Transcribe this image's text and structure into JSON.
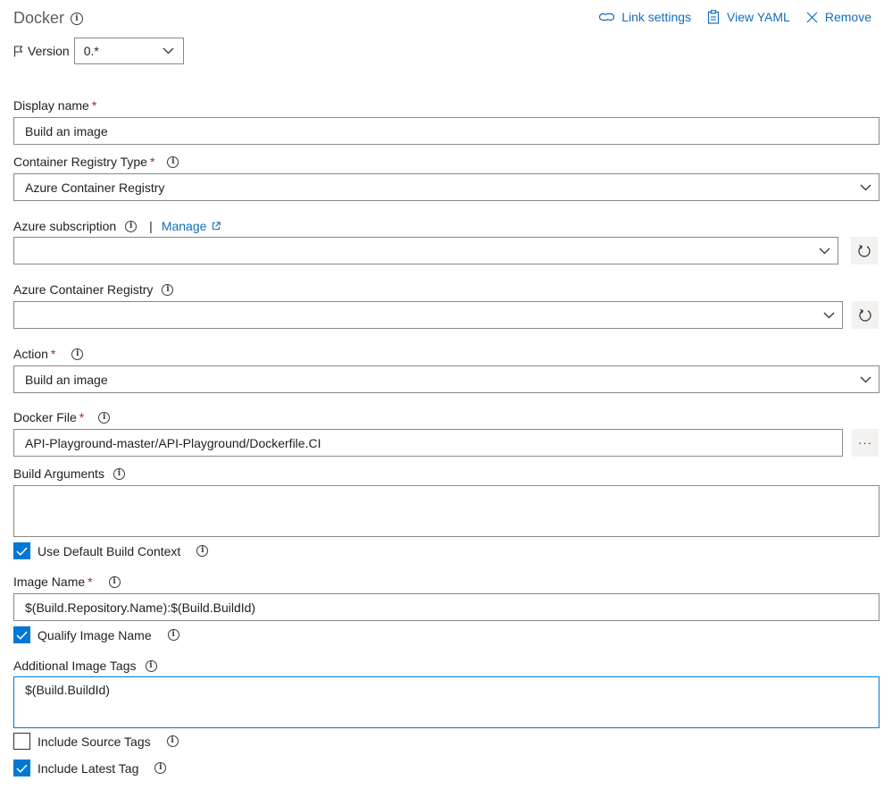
{
  "header": {
    "title": "Docker",
    "links": [
      {
        "label": "Link settings",
        "icon": "link-icon"
      },
      {
        "label": "View YAML",
        "icon": "clipboard-icon"
      },
      {
        "label": "Remove",
        "icon": "close-icon"
      }
    ]
  },
  "version": {
    "label": "Version",
    "value": "0.*"
  },
  "fields": {
    "display_name": {
      "label": "Display name",
      "required": "*",
      "value": "Build an image"
    },
    "registry_type": {
      "label": "Container Registry Type",
      "required": "*",
      "value": "Azure Container Registry"
    },
    "azure_subscription": {
      "label": "Azure subscription",
      "separator": "|",
      "manage_label": "Manage",
      "value": ""
    },
    "azure_registry": {
      "label": "Azure Container Registry",
      "value": ""
    },
    "action": {
      "label": "Action",
      "required": "*",
      "value": "Build an image"
    },
    "docker_file": {
      "label": "Docker File",
      "required": "*",
      "value": "API-Playground-master/API-Playground/Dockerfile.CI",
      "browse_label": "···"
    },
    "build_arguments": {
      "label": "Build Arguments",
      "value": ""
    },
    "use_default_context": {
      "label": "Use Default Build Context",
      "checked": true
    },
    "image_name": {
      "label": "Image Name",
      "required": "*",
      "value": "$(Build.Repository.Name):$(Build.BuildId)"
    },
    "qualify_image_name": {
      "label": "Qualify Image Name",
      "checked": true
    },
    "additional_tags": {
      "label": "Additional Image Tags",
      "value": "$(Build.BuildId)"
    },
    "include_source_tags": {
      "label": "Include Source Tags",
      "checked": false
    },
    "include_latest_tag": {
      "label": "Include Latest Tag",
      "checked": true
    }
  },
  "colors": {
    "accent": "#0078d4",
    "link": "#106ebe",
    "required": "#a4262c",
    "border": "#8a8886"
  }
}
